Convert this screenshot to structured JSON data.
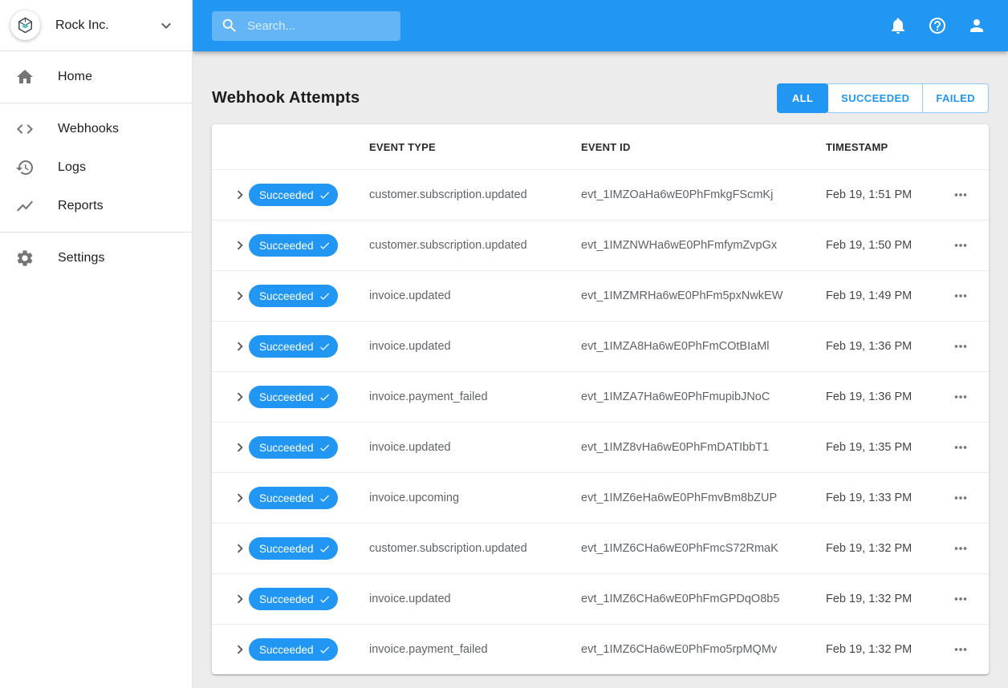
{
  "brand": {
    "company": "Rock Inc."
  },
  "appbar": {
    "search_placeholder": "Search..."
  },
  "sidebar": {
    "items": [
      {
        "label": "Home",
        "icon": "home-icon"
      },
      {
        "label": "Webhooks",
        "icon": "code-icon"
      },
      {
        "label": "Logs",
        "icon": "history-icon"
      },
      {
        "label": "Reports",
        "icon": "trending-up-icon"
      },
      {
        "label": "Settings",
        "icon": "gear-icon"
      }
    ]
  },
  "page": {
    "title": "Webhook Attempts",
    "filters": [
      {
        "label": "ALL",
        "active": true
      },
      {
        "label": "SUCCEEDED",
        "active": false
      },
      {
        "label": "FAILED",
        "active": false
      }
    ]
  },
  "table": {
    "headers": [
      "EVENT TYPE",
      "EVENT ID",
      "TIMESTAMP"
    ],
    "rows": [
      {
        "status": "Succeeded",
        "event_type": "customer.subscription.updated",
        "event_id": "evt_1IMZOaHa6wE0PhFmkgFScmKj",
        "timestamp": "Feb 19, 1:51 PM"
      },
      {
        "status": "Succeeded",
        "event_type": "customer.subscription.updated",
        "event_id": "evt_1IMZNWHa6wE0PhFmfymZvpGx",
        "timestamp": "Feb 19, 1:50 PM"
      },
      {
        "status": "Succeeded",
        "event_type": "invoice.updated",
        "event_id": "evt_1IMZMRHa6wE0PhFm5pxNwkEW",
        "timestamp": "Feb 19, 1:49 PM"
      },
      {
        "status": "Succeeded",
        "event_type": "invoice.updated",
        "event_id": "evt_1IMZA8Ha6wE0PhFmCOtBIaMl",
        "timestamp": "Feb 19, 1:36 PM"
      },
      {
        "status": "Succeeded",
        "event_type": "invoice.payment_failed",
        "event_id": "evt_1IMZA7Ha6wE0PhFmupibJNoC",
        "timestamp": "Feb 19, 1:36 PM"
      },
      {
        "status": "Succeeded",
        "event_type": "invoice.updated",
        "event_id": "evt_1IMZ8vHa6wE0PhFmDATIbbT1",
        "timestamp": "Feb 19, 1:35 PM"
      },
      {
        "status": "Succeeded",
        "event_type": "invoice.upcoming",
        "event_id": "evt_1IMZ6eHa6wE0PhFmvBm8bZUP",
        "timestamp": "Feb 19, 1:33 PM"
      },
      {
        "status": "Succeeded",
        "event_type": "customer.subscription.updated",
        "event_id": "evt_1IMZ6CHa6wE0PhFmcS72RmaK",
        "timestamp": "Feb 19, 1:32 PM"
      },
      {
        "status": "Succeeded",
        "event_type": "invoice.updated",
        "event_id": "evt_1IMZ6CHa6wE0PhFmGPDqO8b5",
        "timestamp": "Feb 19, 1:32 PM"
      },
      {
        "status": "Succeeded",
        "event_type": "invoice.payment_failed",
        "event_id": "evt_1IMZ6CHa6wE0PhFmo5rpMQMv",
        "timestamp": "Feb 19, 1:32 PM"
      }
    ]
  },
  "colors": {
    "appbar_blue": "#2196F3",
    "badge_blue": "#2196F3",
    "active_filter_blue": "#2196F3",
    "logo_teal": "#4EC6C0",
    "content_background": "#ececec"
  }
}
